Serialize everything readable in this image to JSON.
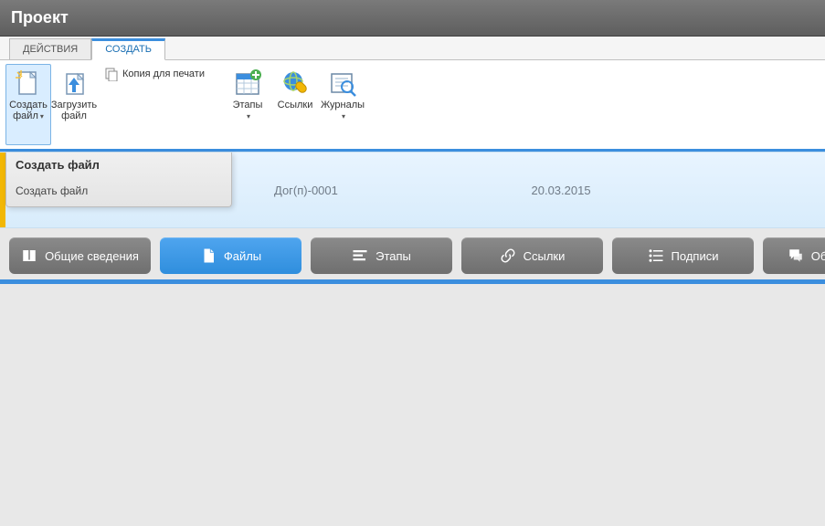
{
  "title": "Проект",
  "ribbonTabs": {
    "actions": "ДЕЙСТВИЯ",
    "create": "СОЗДАТЬ"
  },
  "ribbon": {
    "create_file": "Создать файл",
    "upload_file": "Загрузить файл",
    "print_copy": "Копия для печати",
    "stages": "Этапы",
    "links": "Ссылки",
    "journals": "Журналы"
  },
  "tooltip": {
    "title": "Создать файл",
    "body": "Создать файл"
  },
  "info": {
    "doc_no": "Дог(п)-0001",
    "date": "20.03.2015"
  },
  "nav": {
    "general": "Общие сведения",
    "files": "Файлы",
    "stages": "Этапы",
    "links": "Ссылки",
    "signatures": "Подписи",
    "discussions": "Обсуждения"
  }
}
